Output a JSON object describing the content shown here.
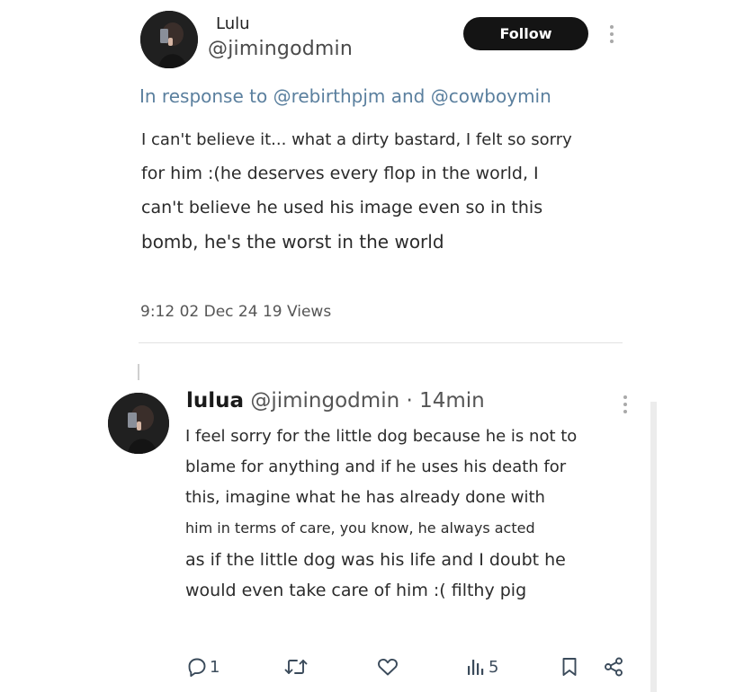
{
  "tweet": {
    "display_name": "Lulu",
    "handle": "@jimingodmin",
    "follow_label": "Follow",
    "in_response_to": "In response to @rebirthpjm and @cowboymin",
    "body_lines": [
      "I can't believe it... what a dirty bastard, I felt so sorry",
      "for him :(he deserves every flop in the world, I",
      "can't believe he used his image even so in this",
      "bomb, he's the worst in the world"
    ],
    "meta": "9:12 02 Dec 24 19 Views"
  },
  "reply": {
    "display_name": "lulua",
    "handle_time": "@jimingodmin · 14min",
    "body_lines": [
      "I feel sorry for the little dog because he is not to",
      "blame for anything and if he uses his death for",
      "this, imagine what he has already done with",
      "him in terms of care, you know, he always acted",
      "as if the little dog was his life and I doubt he",
      "would even take care of him :( filthy pig"
    ],
    "actions": {
      "reply_count": "1",
      "views_count": "5",
      "reply_icon": "reply-icon",
      "retweet_icon": "retweet-icon",
      "like_icon": "heart-icon",
      "views_icon": "views-icon",
      "bookmark_icon": "bookmark-icon",
      "share_icon": "share-icon"
    }
  },
  "colors": {
    "follow_button_bg": "#141414",
    "link": "#5a7f9e",
    "icon": "#3a4a5a"
  }
}
